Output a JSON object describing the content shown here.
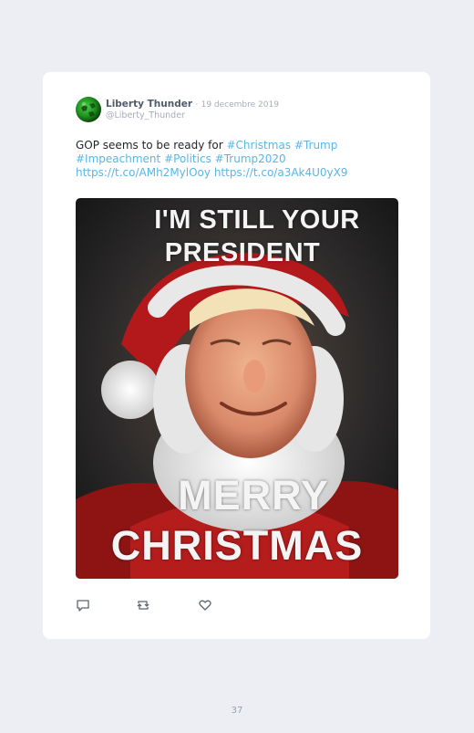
{
  "tweet": {
    "display_name": "Liberty Thunder",
    "separator": "·",
    "date": "19 decembre 2019",
    "handle": "@Liberty_Thunder",
    "text_prefix": "GOP seems to be ready for ",
    "hashtags": [
      "#Christmas",
      "#Trump",
      "#Impeachment",
      "#Politics",
      "#Trump2020"
    ],
    "links": [
      "https://t.co/AMh2MylOoy",
      "https://t.co/a3Ak4U0yX9"
    ],
    "image_caption_top": [
      "I'M STILL YOUR",
      "PRESIDENT"
    ],
    "image_caption_bottom": [
      "MERRY",
      "CHRISTMAS"
    ]
  },
  "actions": {
    "reply_icon": "reply-icon",
    "retweet_icon": "retweet-icon",
    "like_icon": "heart-icon"
  },
  "footer": {
    "page_number": "37"
  },
  "colors": {
    "link": "#59b6e8",
    "name": "#4f5b69",
    "muted": "#a6adb8",
    "background": "#eceef3"
  }
}
